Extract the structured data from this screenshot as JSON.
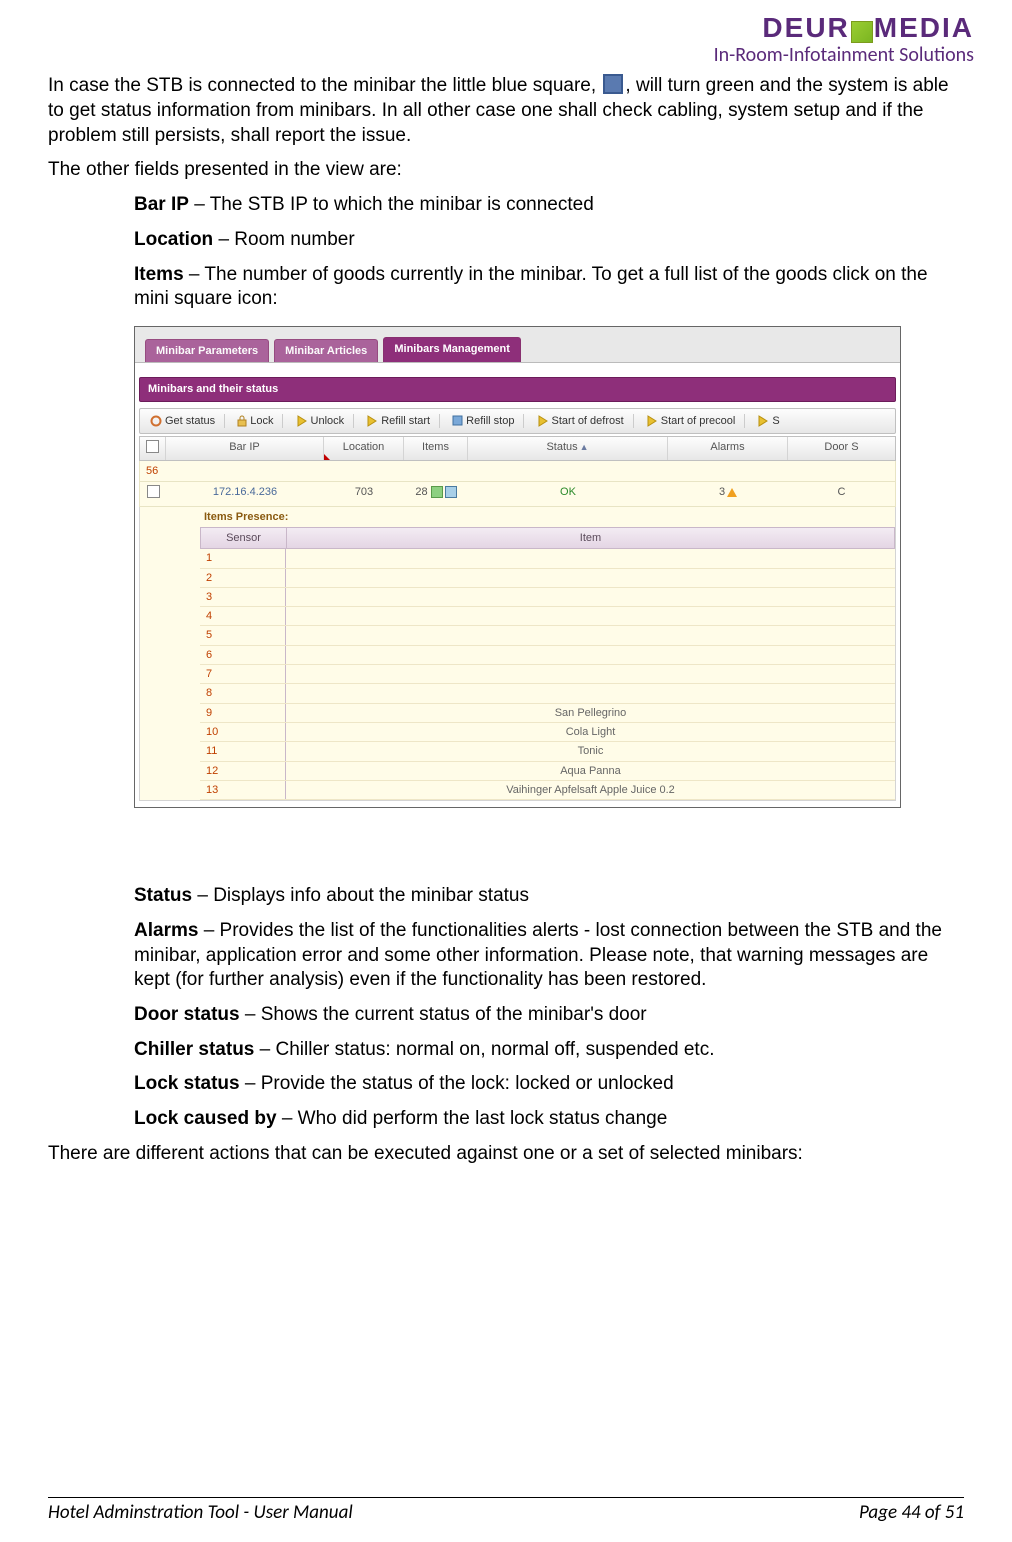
{
  "logo": {
    "main_pre": "DEUR",
    "main_post": "MEDIA",
    "sub": "In-Room-Infotainment Solutions"
  },
  "p1a": "In case the STB is connected to the minibar the little blue square, ",
  "p1b": ", will turn green and the system is able to get status information from minibars. In all other case one shall check cabling, system setup and if the problem still persists, shall report the issue.",
  "p2": "The other fields presented in the view are:",
  "f_barip_l": "Bar IP",
  "f_barip_t": " – The STB IP to which the minibar is connected",
  "f_loc_l": "Location",
  "f_loc_t": " – Room number",
  "f_items_l": "Items",
  "f_items_t": " – The number of goods currently in the minibar. To get a full list of the goods click on the mini square icon:",
  "shot": {
    "tabs": [
      "Minibar Parameters",
      "Minibar Articles",
      "Minibars Management"
    ],
    "panel_title": "Minibars and their status",
    "toolbar": [
      "Get status",
      "Lock",
      "Unlock",
      "Refill start",
      "Refill stop",
      "Start of defrost",
      "Start of precool",
      "S"
    ],
    "gridcols": {
      "barip": "Bar IP",
      "loc": "Location",
      "items": "Items",
      "status": "Status",
      "alarms": "Alarms",
      "door": "Door S"
    },
    "group": "56",
    "row": {
      "ip": "172.16.4.236",
      "loc": "703",
      "items": "28",
      "status": "OK",
      "alarms": "3",
      "door": "C"
    },
    "sub_title": "Items Presence:",
    "sub_cols": {
      "sensor": "Sensor",
      "item": "Item"
    },
    "sub_rows": [
      {
        "s": "1",
        "i": ""
      },
      {
        "s": "2",
        "i": ""
      },
      {
        "s": "3",
        "i": ""
      },
      {
        "s": "4",
        "i": ""
      },
      {
        "s": "5",
        "i": ""
      },
      {
        "s": "6",
        "i": ""
      },
      {
        "s": "7",
        "i": ""
      },
      {
        "s": "8",
        "i": ""
      },
      {
        "s": "9",
        "i": "San Pellegrino"
      },
      {
        "s": "10",
        "i": "Cola Light"
      },
      {
        "s": "11",
        "i": "Tonic"
      },
      {
        "s": "12",
        "i": "Aqua Panna"
      },
      {
        "s": "13",
        "i": "Vaihinger Apfelsaft Apple Juice 0.2"
      }
    ]
  },
  "f_status_l": "Status",
  "f_status_t": " – Displays info about the minibar status",
  "f_alarms_l": "Alarms",
  "f_alarms_t": " – Provides the list of the functionalities alerts - lost connection between the STB and the minibar, application error and some other information. Please note, that warning messages are kept (for further analysis) even if the functionality has been restored.",
  "f_door_l": "Door status",
  "f_door_t": " – Shows the current status of the minibar's door",
  "f_chill_l": "Chiller status",
  "f_chill_t": " – Chiller status: normal on, normal off, suspended etc.",
  "f_lockst_l": "Lock status",
  "f_lockst_t": " – Provide the status of the lock: locked or unlocked",
  "f_lockby_l": "Lock caused by",
  "f_lockby_t": " – Who did perform the last lock status change",
  "p3": "There are different actions that can be executed against one or a set of selected minibars:",
  "footer": {
    "left": "Hotel Adminstration Tool - User Manual",
    "right": "Page 44 of 51"
  }
}
